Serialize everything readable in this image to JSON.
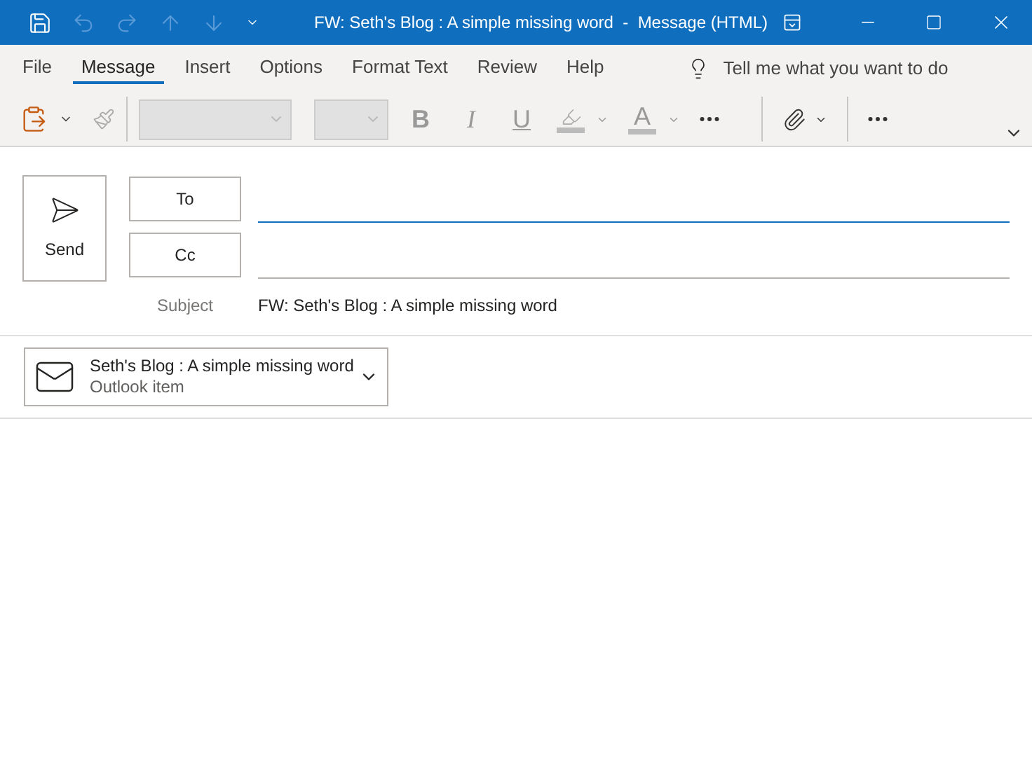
{
  "window": {
    "title": "FW: Seth's Blog : A simple missing word  -  Message (HTML)"
  },
  "quick_access": [
    {
      "kind": "save",
      "disabled": false
    },
    {
      "kind": "undo",
      "disabled": true
    },
    {
      "kind": "redo",
      "disabled": true
    },
    {
      "kind": "up",
      "disabled": true
    },
    {
      "kind": "down",
      "disabled": true
    },
    {
      "kind": "customize",
      "disabled": false
    }
  ],
  "tabs": [
    {
      "label": "File",
      "selected": false
    },
    {
      "label": "Message",
      "selected": true
    },
    {
      "label": "Insert",
      "selected": false
    },
    {
      "label": "Options",
      "selected": false
    },
    {
      "label": "Format Text",
      "selected": false
    },
    {
      "label": "Review",
      "selected": false
    },
    {
      "label": "Help",
      "selected": false
    }
  ],
  "tell_me": {
    "placeholder": "Tell me what you want to do"
  },
  "format_buttons": [
    {
      "label": "B",
      "kind": "bold"
    },
    {
      "label": "I",
      "kind": "italic"
    },
    {
      "label": "U",
      "kind": "underline"
    }
  ],
  "font_color": {
    "label": "A"
  },
  "compose": {
    "send": "Send",
    "to": {
      "label": "To"
    },
    "cc": {
      "label": "Cc"
    },
    "subject": {
      "label": "Subject",
      "value": "FW: Seth's Blog : A simple missing word"
    }
  },
  "attachment": {
    "name": "Seth's Blog : A simple missing word",
    "type": "Outlook item"
  }
}
